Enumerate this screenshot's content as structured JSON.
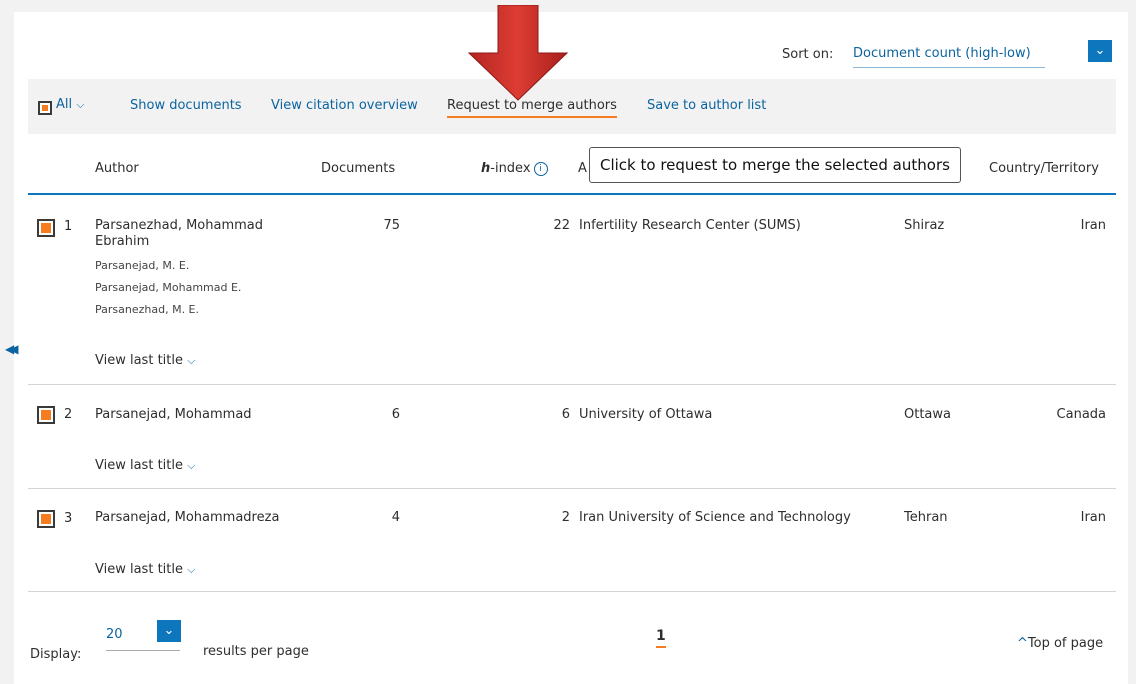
{
  "colors": {
    "accent_orange": "#f57c1f",
    "link_blue": "#0b64a0",
    "rule_blue": "#0e76bc",
    "arrow_red": "#c9302c"
  },
  "icons": {
    "collapse": "double-chevron-left-icon",
    "dropdown": "chevron-down-icon",
    "info": "info-circle-icon",
    "up": "chevron-up-icon"
  },
  "sort": {
    "label": "Sort on:",
    "value": "Document count (high-low)"
  },
  "toolbar": {
    "all_label": "All",
    "show_documents": "Show documents",
    "view_citation_overview": "View citation overview",
    "request_merge": "Request to merge authors",
    "save_to_author_list": "Save to author list"
  },
  "tooltip": "Click to request to merge the selected authors",
  "table": {
    "headers": {
      "author": "Author",
      "documents": "Documents",
      "h_prefix": "h",
      "h_suffix": "-index",
      "affiliation_initial": "A",
      "country": "Country/Territory"
    },
    "rows": [
      {
        "num": "1",
        "author_line1": "Parsanezhad, Mohammad",
        "author_line2": "Ebrahim",
        "variants": [
          "Parsanejad, M. E.",
          "Parsanejad, Mohammad E.",
          "Parsanezhad, M. E."
        ],
        "documents": "75",
        "h_index": "22",
        "affiliation": "Infertility Research Center (SUMS)",
        "city": "Shiraz",
        "country": "Iran",
        "view_last_title": "View last title"
      },
      {
        "num": "2",
        "author_line1": "Parsanejad, Mohammad",
        "documents": "6",
        "h_index": "6",
        "affiliation": "University of Ottawa",
        "city": "Ottawa",
        "country": "Canada",
        "view_last_title": "View last title"
      },
      {
        "num": "3",
        "author_line1": "Parsanejad, Mohammadreza",
        "documents": "4",
        "h_index": "2",
        "affiliation": "Iran University of Science and Technology",
        "city": "Tehran",
        "country": "Iran",
        "view_last_title": "View last title"
      }
    ]
  },
  "footer": {
    "display_label": "Display:",
    "per_page_value": "20",
    "results_per_page": "results per page",
    "current_page": "1",
    "top_of_page": "Top of page"
  }
}
